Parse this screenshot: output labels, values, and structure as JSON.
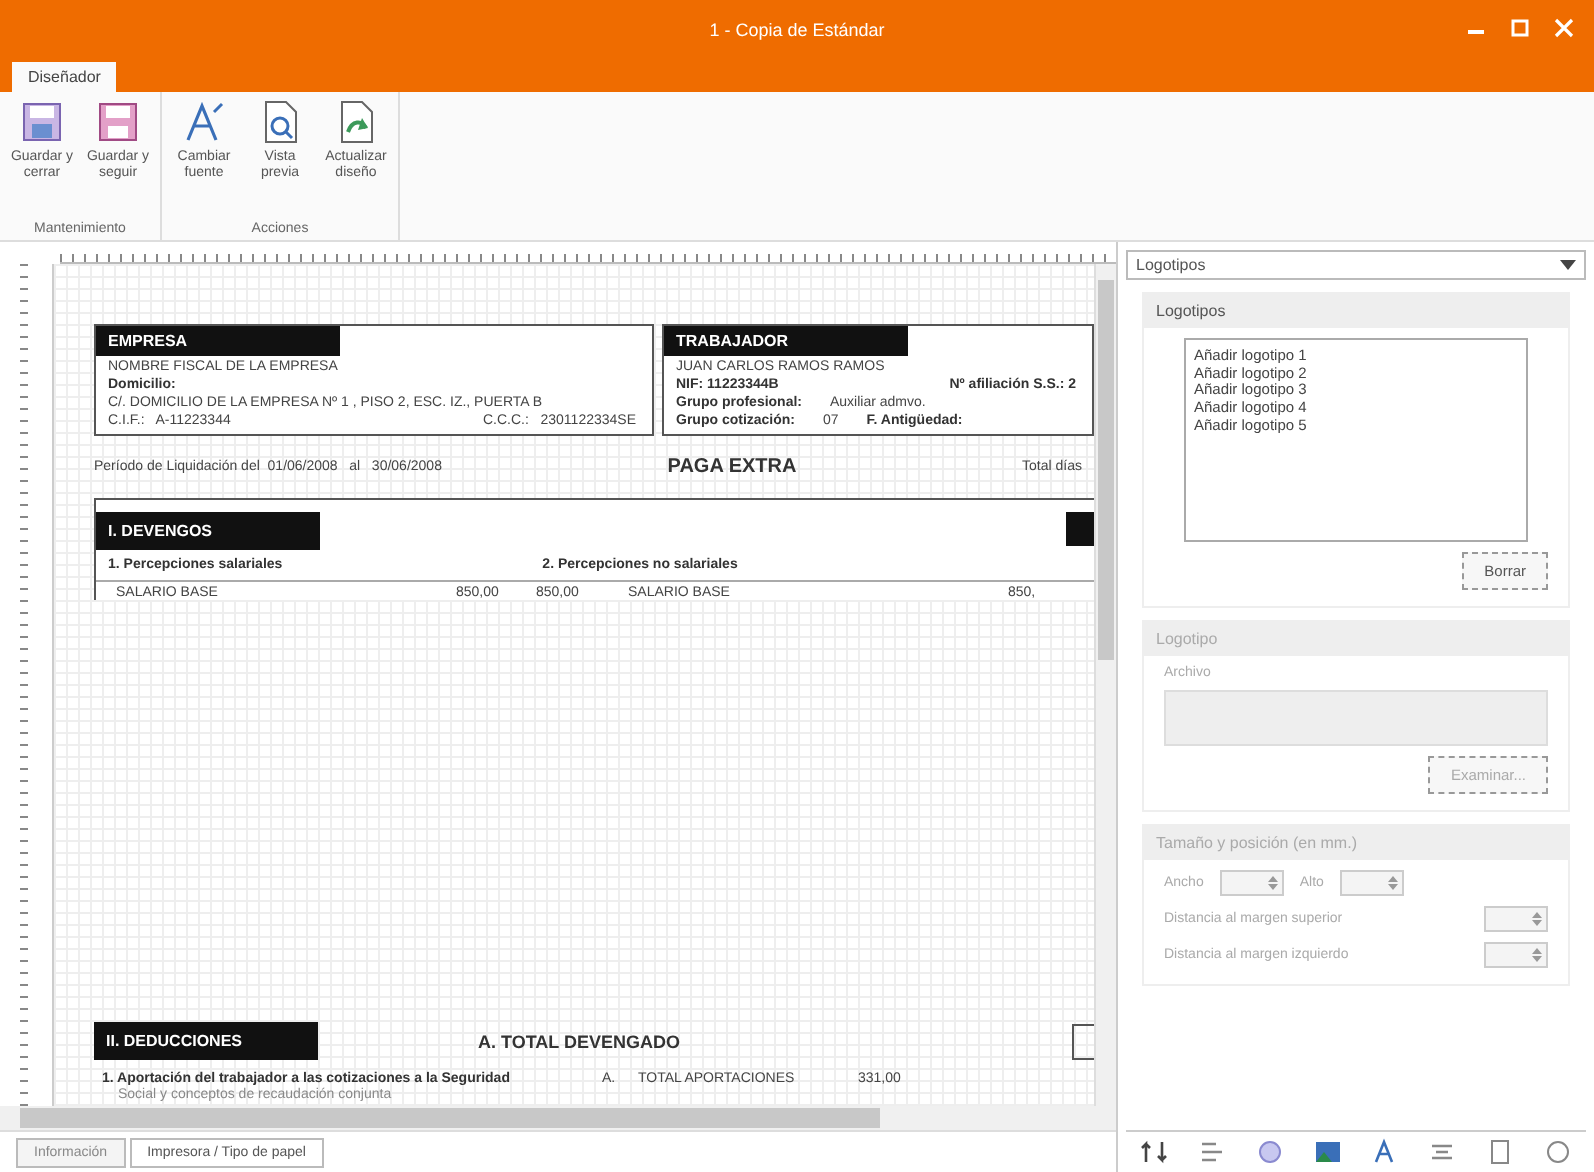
{
  "window": {
    "title": "1 - Copia de Estándar"
  },
  "ribbon_tabs": [
    {
      "label": "Diseñador",
      "selected": true
    }
  ],
  "ribbon_groups": [
    {
      "label": "Mantenimiento",
      "buttons": [
        {
          "label": "Guardar y cerrar",
          "kind": "save-close"
        },
        {
          "label": "Guardar y seguir",
          "kind": "save"
        }
      ]
    },
    {
      "label": "Acciones",
      "buttons": [
        {
          "label": "Cambiar fuente",
          "kind": "font"
        },
        {
          "label": "Vista previa",
          "kind": "preview"
        },
        {
          "label": "Actualizar diseño",
          "kind": "refresh"
        }
      ]
    }
  ],
  "document": {
    "empresa": {
      "heading": "EMPRESA",
      "name": "NOMBRE FISCAL DE LA EMPRESA",
      "domicilio_label": "Domicilio:",
      "address": "C/. DOMICILIO DE LA EMPRESA Nº 1 , PISO 2, ESC. IZ., PUERTA B",
      "cif": "C.I.F.:   A-11223344",
      "ccc": "C.C.C.:   2301122334SE"
    },
    "trabajador": {
      "heading": "TRABAJADOR",
      "name": "JUAN CARLOS RAMOS RAMOS",
      "nif": "NIF: 11223344B",
      "afiliacion": "Nº afiliación S.S.: 2",
      "grupo_profesional_label": "Grupo profesional:",
      "grupo_profesional": "Auxiliar admvo.",
      "grupo_cotizacion_label": "Grupo cotización:",
      "grupo_cotizacion": "07",
      "antiguedad_label": "F. Antigüedad:"
    },
    "period": "Período de Liquidación del  01/06/2008   al   30/06/2008",
    "pay_title": "PAGA EXTRA",
    "total_days": "Total días",
    "devengos": {
      "heading": "I. DEVENGOS",
      "col_1": "1. Percepciones salariales",
      "col_2": "2. Percepciones no salariales",
      "rows": [
        {
          "concept": "SALARIO BASE",
          "amount_1": "850,00",
          "amount_2": "850,00",
          "concept_2": "SALARIO BASE",
          "amount_3": "850,"
        }
      ]
    },
    "deducciones": {
      "heading": "II. DEDUCCIONES",
      "total_devengado": "A. TOTAL DEVENGADO",
      "line_1": "1. Aportación del trabajador a las cotizaciones a la Seguridad",
      "line_2": "Social y conceptos de recaudación conjunta",
      "total_mark": "A.",
      "total_label": "TOTAL APORTACIONES",
      "total_value": "331,00"
    }
  },
  "bottom_tabs": [
    {
      "label": "Información",
      "selected": false
    },
    {
      "label": "Impresora / Tipo de papel",
      "selected": true
    }
  ],
  "panel": {
    "dropdown": "Logotipos",
    "logos_section": {
      "title": "Logotipos",
      "items": [
        "Añadir logotipo 1",
        "Añadir logotipo 2",
        "Añadir logotipo 3",
        "Añadir logotipo 4",
        "Añadir logotipo 5"
      ],
      "button": "Borrar"
    },
    "logo_section": {
      "title": "Logotipo",
      "file_label": "Archivo",
      "button": "Examinar...",
      "disabled": true
    },
    "size_section": {
      "title": "Tamaño y posición (en mm.)",
      "width_label": "Ancho",
      "height_label": "Alto",
      "top_label": "Distancia al margen superior",
      "left_label": "Distancia al margen izquierdo",
      "disabled": true
    }
  }
}
